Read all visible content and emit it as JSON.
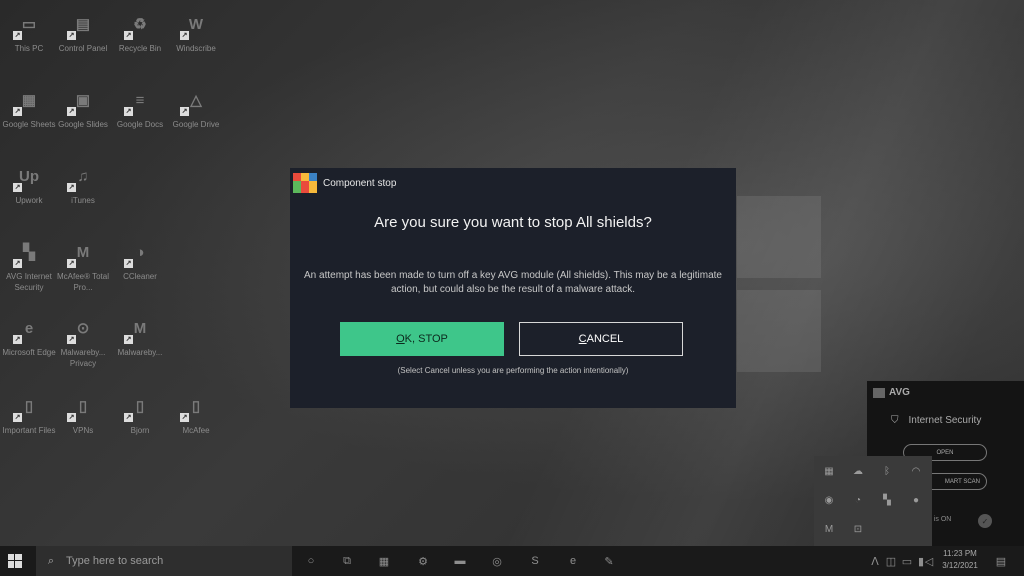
{
  "desktop": {
    "icons": [
      {
        "label": "This PC",
        "glyph": "▭"
      },
      {
        "label": "Control Panel",
        "glyph": "▤"
      },
      {
        "label": "Recycle Bin",
        "glyph": "♻"
      },
      {
        "label": "Windscribe",
        "glyph": "W"
      },
      {
        "label": "Google Sheets",
        "glyph": "▦"
      },
      {
        "label": "Google Slides",
        "glyph": "▣"
      },
      {
        "label": "Google Docs",
        "glyph": "≡"
      },
      {
        "label": "Google Drive",
        "glyph": "△"
      },
      {
        "label": "Upwork",
        "glyph": "Up"
      },
      {
        "label": "iTunes",
        "glyph": "♫"
      },
      {
        "label": "AVG Internet Security",
        "glyph": "▚"
      },
      {
        "label": "McAfee® Total Pro...",
        "glyph": "M"
      },
      {
        "label": "CCleaner",
        "glyph": "◑"
      },
      {
        "label": "Microsoft Edge",
        "glyph": "e"
      },
      {
        "label": "Malwareby... Privacy",
        "glyph": "⊙"
      },
      {
        "label": "Malwareby...",
        "glyph": "M"
      },
      {
        "label": "Important Files",
        "glyph": "▯"
      },
      {
        "label": "VPNs",
        "glyph": "▯"
      },
      {
        "label": "Bjorn",
        "glyph": "▯"
      },
      {
        "label": "McAfee",
        "glyph": "▯"
      }
    ]
  },
  "dialog": {
    "title": "Component stop",
    "heading": "Are you sure you want to stop All shields?",
    "body": "An attempt has been made to turn off a key AVG module (All shields). This may be a legitimate action, but could also be the result of a malware attack.",
    "ok_underlined": "O",
    "ok_rest": "K, STOP",
    "cancel_underlined": "C",
    "cancel_rest": "ANCEL",
    "hint": "(Select Cancel unless you are performing the action intentionally)",
    "colors": {
      "background": "#1c202a",
      "ok": "#3ec68a"
    }
  },
  "avg_popup": {
    "brand": "AVG",
    "product": "Internet Security",
    "open_label": "OPEN",
    "smart_scan_label": "MART SCAN",
    "status": "n is ON"
  },
  "taskbar": {
    "search_placeholder": "Type here to search",
    "time": "11:23 PM",
    "date": "3/12/2021"
  }
}
